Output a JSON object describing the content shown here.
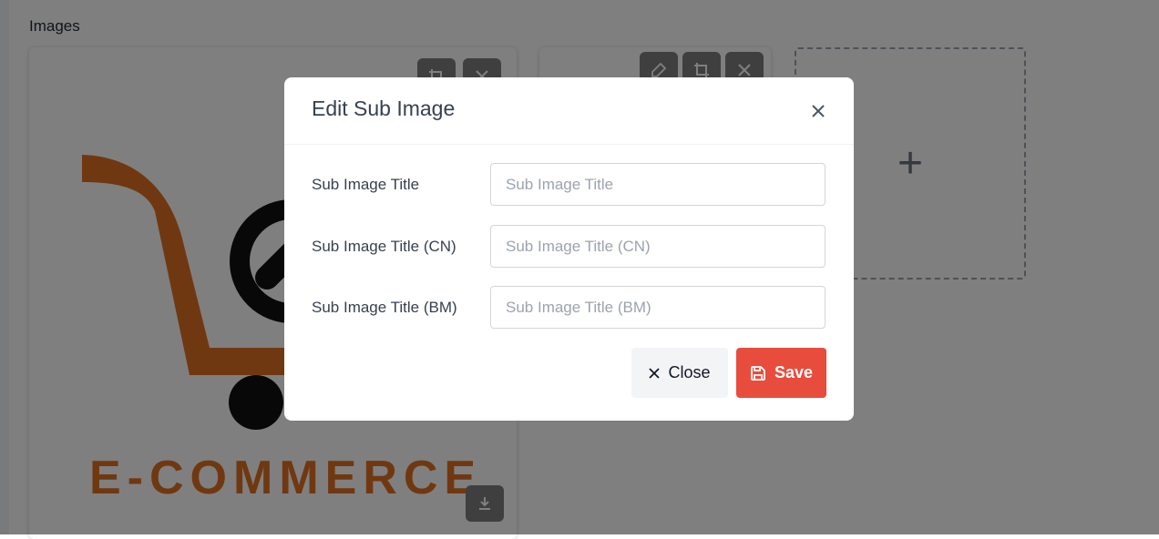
{
  "page": {
    "section_label": "Images",
    "main_image": {
      "logo_text": "E-COMMERCE",
      "actions": [
        "crop-icon",
        "close-icon"
      ],
      "download_icon": "download-icon"
    },
    "second_image": {
      "actions": [
        "edit-icon",
        "crop-icon",
        "close-icon"
      ]
    },
    "add_image": {
      "icon": "plus-icon",
      "label": "+"
    }
  },
  "modal": {
    "title": "Edit Sub Image",
    "close_icon": "close-icon",
    "fields": [
      {
        "label": "Sub Image Title",
        "placeholder": "Sub Image Title",
        "value": ""
      },
      {
        "label": "Sub Image Title (CN)",
        "placeholder": "Sub Image Title (CN)",
        "value": ""
      },
      {
        "label": "Sub Image Title (BM)",
        "placeholder": "Sub Image Title (BM)",
        "value": ""
      }
    ],
    "buttons": {
      "close_label": "Close",
      "save_label": "Save"
    }
  },
  "colors": {
    "save_button": "#e84c3d",
    "close_button_bg": "#f3f4f6",
    "logo_orange": "#e07020",
    "overlay": "rgba(0,0,0,0.5)"
  }
}
